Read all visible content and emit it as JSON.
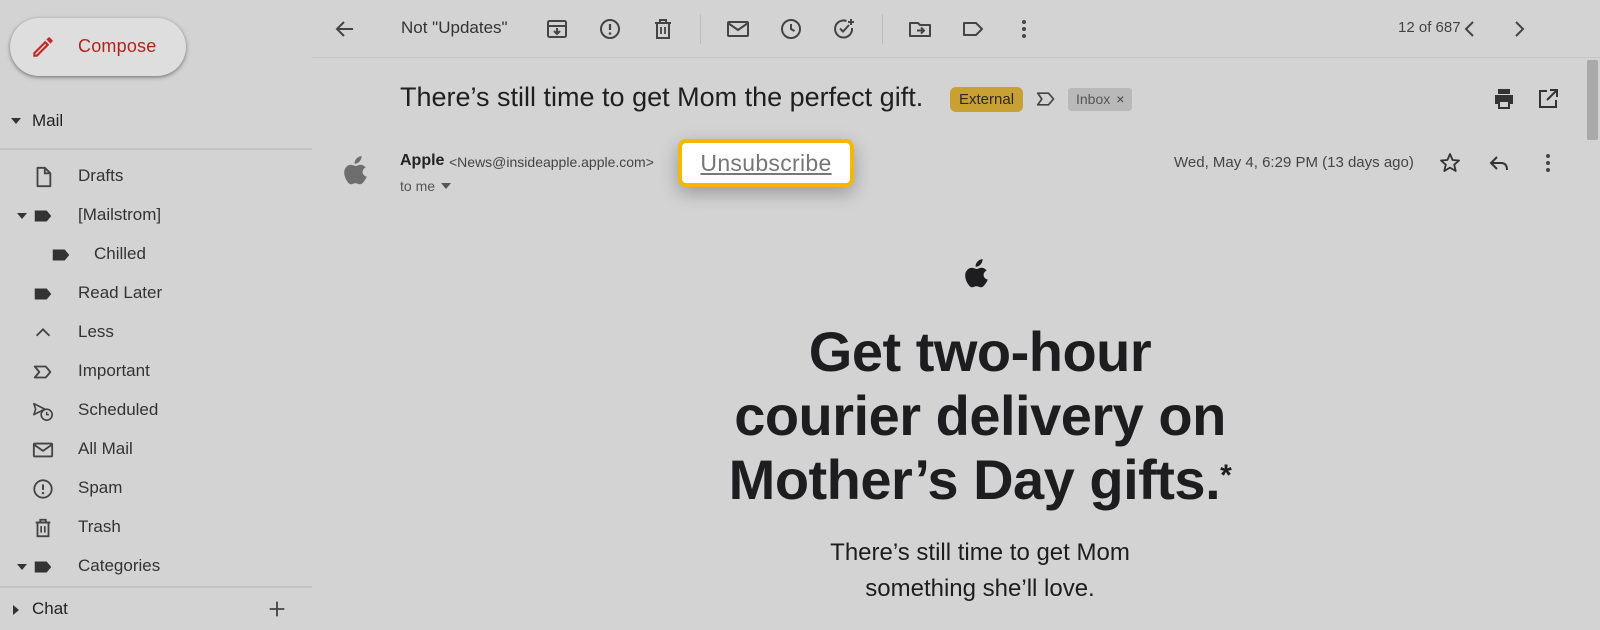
{
  "compose": {
    "label": "Compose"
  },
  "sidebar": {
    "mail_label": "Mail",
    "items": [
      {
        "label": "Drafts",
        "icon": "draft-icon"
      },
      {
        "label": "[Mailstrom]",
        "icon": "label-icon"
      },
      {
        "label": "Chilled",
        "icon": "label-icon"
      },
      {
        "label": "Read Later",
        "icon": "label-icon"
      },
      {
        "label": "Less",
        "icon": "chevron-up-icon"
      },
      {
        "label": "Important",
        "icon": "important-icon"
      },
      {
        "label": "Scheduled",
        "icon": "scheduled-icon"
      },
      {
        "label": "All Mail",
        "icon": "mail-icon"
      },
      {
        "label": "Spam",
        "icon": "spam-icon"
      },
      {
        "label": "Trash",
        "icon": "trash-icon"
      },
      {
        "label": "Categories",
        "icon": "label-icon"
      }
    ],
    "chat_label": "Chat"
  },
  "toolbar": {
    "back_context": "Not \"Updates\"",
    "pager": "12 of 687"
  },
  "message": {
    "subject": "There’s still time to get Mom the perfect gift.",
    "badge_external": "External",
    "badge_inbox": "Inbox",
    "badge_inbox_remove": "×",
    "sender_name": "Apple",
    "sender_email": "<News@insideapple.apple.com>",
    "unsubscribe": "Unsubscribe",
    "to": "to me",
    "date": "Wed, May 4, 6:29 PM (13 days ago)"
  },
  "email_body": {
    "headline_1": "Get two-hour",
    "headline_2": "courier delivery on",
    "headline_3": "Mother’s Day gifts.",
    "headline_mark": "*",
    "subline_1": "There’s still time to get Mom",
    "subline_2": "something she’ll love."
  },
  "colors": {
    "compose_text": "#b42318",
    "external_badge": "#c9a032",
    "unsubscribe_highlight": "#f5b800",
    "background": "#d3d3d3"
  }
}
